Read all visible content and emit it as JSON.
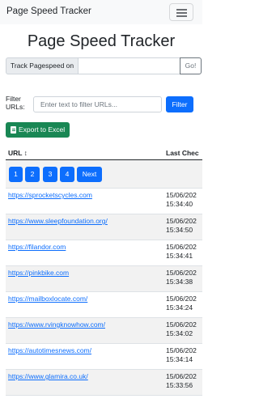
{
  "navbar": {
    "brand": "Page Speed Tracker"
  },
  "page": {
    "title": "Page Speed Tracker"
  },
  "track": {
    "addon_label": "Track Pagespeed on",
    "url_value": "",
    "go_label": "Go!"
  },
  "filter": {
    "label": "Filter URLs:",
    "placeholder": "Enter text to filter URLs...",
    "button_label": "Filter"
  },
  "export": {
    "label": "Export to Excel"
  },
  "table": {
    "columns": {
      "url": "URL ↕",
      "last_checked": "Last Chec"
    },
    "pagination": [
      "1",
      "2",
      "3",
      "4",
      "Next"
    ],
    "rows": [
      {
        "url": "https://sprocketscycles.com",
        "date": "15/06/202",
        "time": "15:34:40"
      },
      {
        "url": "https://www.sleepfoundation.org/",
        "date": "15/06/202",
        "time": "15:34:50"
      },
      {
        "url": "https://filandor.com",
        "date": "15/06/202",
        "time": "15:34:41"
      },
      {
        "url": "https://pinkbike.com",
        "date": "15/06/202",
        "time": "15:34:38"
      },
      {
        "url": "https://mailboxlocate.com/",
        "date": "15/06/202",
        "time": "15:34:24"
      },
      {
        "url": "https://www.rvingknowhow.com/",
        "date": "15/06/202",
        "time": "15:34:02"
      },
      {
        "url": "https://autotimesnews.com/",
        "date": "15/06/202",
        "time": "15:34:14"
      },
      {
        "url": "https://www.glamira.co.uk/",
        "date": "15/06/202",
        "time": "15:33:56"
      }
    ]
  },
  "colors": {
    "primary": "#0d6efd",
    "success": "#198754",
    "navbar_bg": "#f8f9fa",
    "stripe": "#f2f2f2"
  }
}
